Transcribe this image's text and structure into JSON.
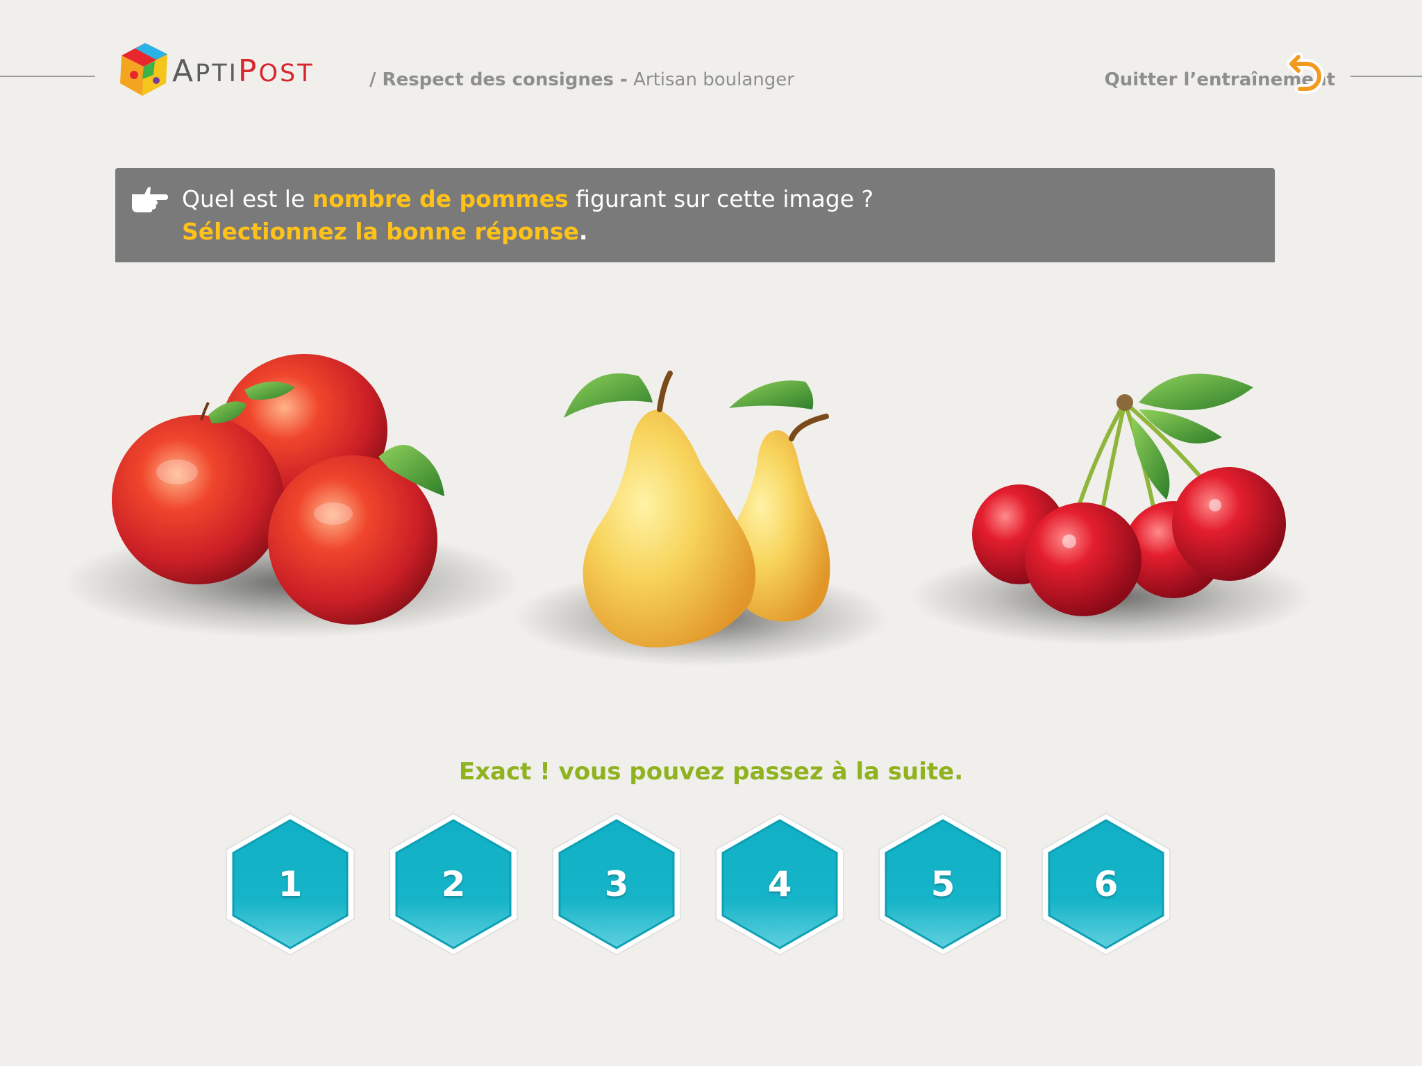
{
  "header": {
    "logo": {
      "part1_initial": "A",
      "part1_rest": "PTI",
      "part2_initial": "P",
      "part2_rest": "OST"
    },
    "breadcrumb": {
      "section": "/ Respect des consignes -",
      "context": "Artisan boulanger"
    },
    "quit_label": "Quitter l’entraînement"
  },
  "question": {
    "line1_before": "Quel est le",
    "line1_highlight": "nombre de pommes",
    "line1_after": "figurant sur cette image ?",
    "line2_highlight": "Sélectionnez la bonne réponse",
    "line2_after": "."
  },
  "feedback": "Exact ! vous pouvez passez à la suite.",
  "answers": [
    "1",
    "2",
    "3",
    "4",
    "5",
    "6"
  ],
  "colors": {
    "background": "#f0efeb",
    "banner": "#7a7a7a",
    "highlight": "#ffc21a",
    "feedback": "#8fb21f",
    "hex_button": "#16b4c8",
    "logo_red": "#d6262e"
  },
  "images": [
    "apples",
    "pears",
    "cherries"
  ]
}
